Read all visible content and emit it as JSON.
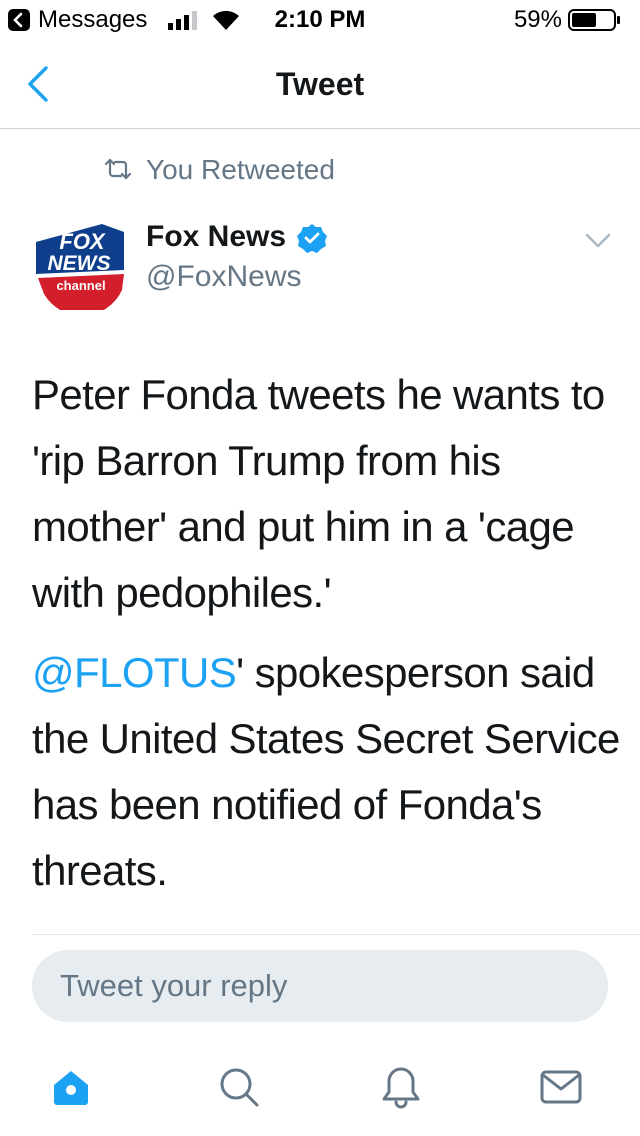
{
  "status_bar": {
    "back_app": "Messages",
    "time": "2:10 PM",
    "battery_percent": "59%",
    "battery_level": 0.59
  },
  "nav": {
    "title": "Tweet",
    "back_icon": "chevron-left-icon"
  },
  "retweet": {
    "label": "You Retweeted"
  },
  "author": {
    "name": "Fox News",
    "handle": "@FoxNews",
    "verified": true,
    "avatar_text": [
      "FOX",
      "NEWS",
      "channel"
    ]
  },
  "tweet": {
    "paragraph1": "Peter Fonda tweets he wants to 'rip Barron Trump from his mother' and put him in a 'cage with pedophiles.'",
    "paragraph2_mention": "@FLOTUS",
    "paragraph2_rest": "' spokesperson said the United States Secret Service has been notified of Fonda's threats."
  },
  "reply": {
    "placeholder": "Tweet your reply"
  },
  "tab_bar": {
    "items": [
      "home-icon",
      "search-icon",
      "bell-icon",
      "mail-icon"
    ],
    "active": "home-icon"
  },
  "colors": {
    "accent": "#1da1f2",
    "secondary_text": "#657786",
    "reply_background": "#e6ecf0"
  }
}
